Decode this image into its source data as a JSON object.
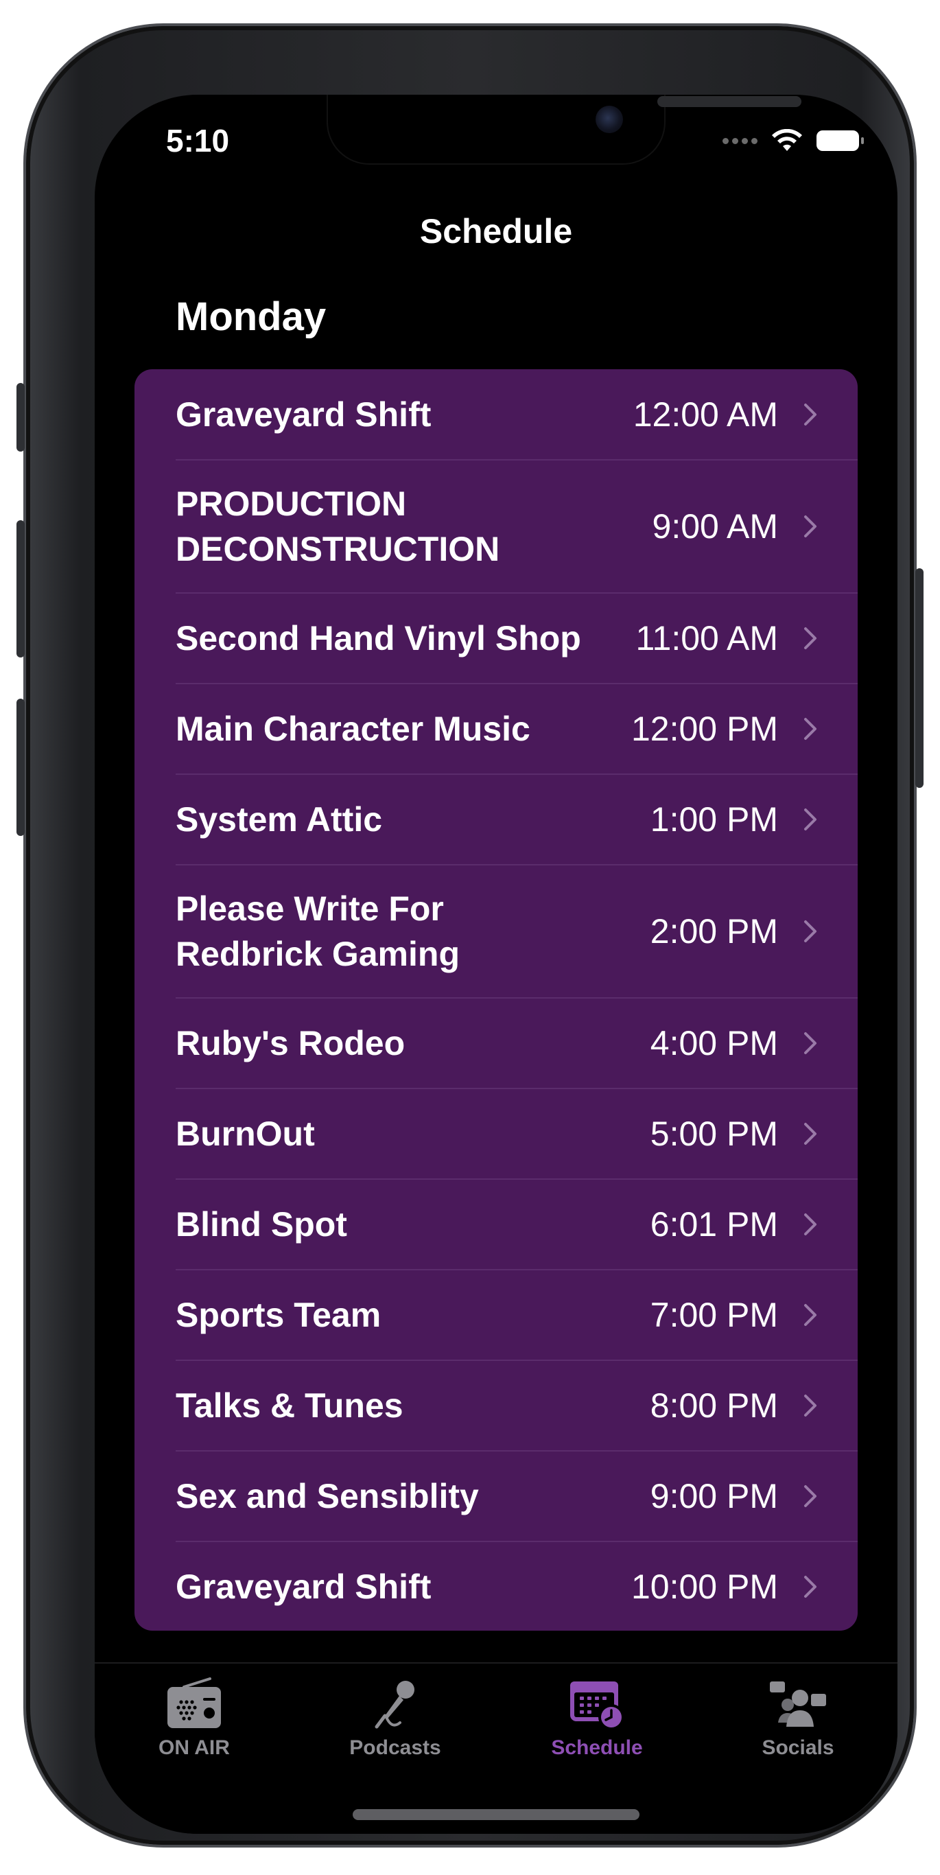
{
  "status_bar": {
    "time": "5:10"
  },
  "nav": {
    "title": "Schedule"
  },
  "schedule": {
    "day": "Monday",
    "items": [
      {
        "title": "Graveyard Shift",
        "time": "12:00 AM"
      },
      {
        "title": "PRODUCTION DECONSTRUCTION",
        "time": "9:00 AM"
      },
      {
        "title": "Second Hand Vinyl Shop",
        "time": "11:00 AM"
      },
      {
        "title": "Main Character Music",
        "time": "12:00 PM"
      },
      {
        "title": "System Attic",
        "time": "1:00 PM"
      },
      {
        "title": "Please Write For Redbrick Gaming",
        "time": "2:00 PM"
      },
      {
        "title": "Ruby's Rodeo",
        "time": "4:00 PM"
      },
      {
        "title": "BurnOut",
        "time": "5:00 PM"
      },
      {
        "title": "Blind Spot",
        "time": "6:01 PM"
      },
      {
        "title": "Sports Team",
        "time": "7:00 PM"
      },
      {
        "title": "Talks & Tunes",
        "time": "8:00 PM"
      },
      {
        "title": "Sex and Sensiblity",
        "time": "9:00 PM"
      },
      {
        "title": "Graveyard Shift",
        "time": "10:00 PM"
      }
    ]
  },
  "tab_bar": {
    "tabs": [
      {
        "label": "ON AIR",
        "icon": "radio-icon"
      },
      {
        "label": "Podcasts",
        "icon": "microphone-icon"
      },
      {
        "label": "Schedule",
        "icon": "calendar-clock-icon",
        "selected": true
      },
      {
        "label": "Socials",
        "icon": "people-icon"
      }
    ]
  },
  "colors": {
    "accent": "#8e4fb4",
    "list_background": "#4a195a",
    "inactive_tab": "#8e8e93"
  }
}
